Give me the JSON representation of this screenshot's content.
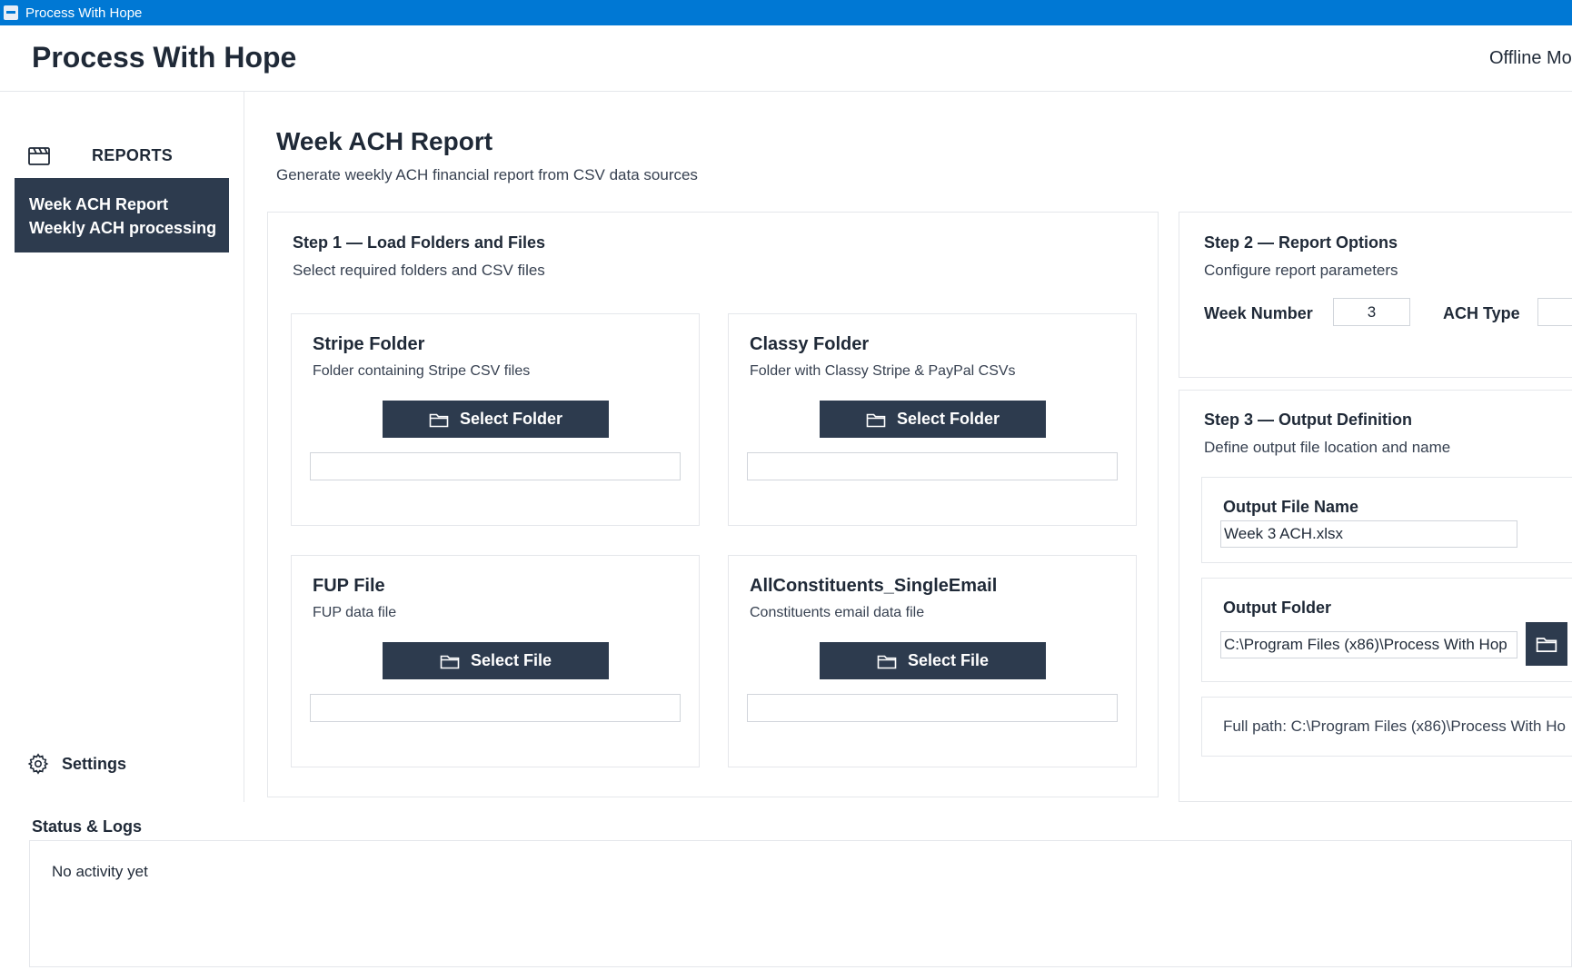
{
  "window": {
    "title": "Process With Hope"
  },
  "header": {
    "brand": "Process With Hope",
    "mode": "Offline Mo"
  },
  "sidebar": {
    "section_label": "REPORTS",
    "nav_item": {
      "title": "Week ACH Report",
      "subtitle": "Weekly ACH processing"
    },
    "settings_label": "Settings"
  },
  "main": {
    "title": "Week ACH Report",
    "subtitle": "Generate weekly ACH financial report from CSV data sources"
  },
  "step1": {
    "title": "Step 1 — Load Folders and Files",
    "subtitle": "Select required folders and CSV files",
    "cards": [
      {
        "title": "Stripe Folder",
        "subtitle": "Folder containing Stripe CSV files",
        "button": "Select Folder",
        "value": ""
      },
      {
        "title": "Classy Folder",
        "subtitle": "Folder with Classy Stripe & PayPal CSVs",
        "button": "Select Folder",
        "value": ""
      },
      {
        "title": "FUP File",
        "subtitle": "FUP data file",
        "button": "Select File",
        "value": ""
      },
      {
        "title": "AllConstituents_SingleEmail",
        "subtitle": "Constituents email data file",
        "button": "Select File",
        "value": ""
      }
    ]
  },
  "step2": {
    "title": "Step 2 — Report Options",
    "subtitle": "Configure report parameters",
    "week_label": "Week Number",
    "week_value": "3",
    "ach_label": "ACH Type",
    "ach_value": ""
  },
  "step3": {
    "title": "Step 3 — Output Definition",
    "subtitle": "Define output file location and name",
    "file_name_label": "Output File Name",
    "file_name_value": "Week 3 ACH.xlsx",
    "folder_label": "Output Folder",
    "folder_value": "C:\\Program Files (x86)\\Process With Hop",
    "full_path": "Full path: C:\\Program Files (x86)\\Process With Ho"
  },
  "status": {
    "title": "Status & Logs",
    "message": "No activity yet"
  },
  "colors": {
    "titlebar": "#0078d4",
    "primary_dark": "#2d3b4e",
    "border": "#e5e7eb"
  }
}
